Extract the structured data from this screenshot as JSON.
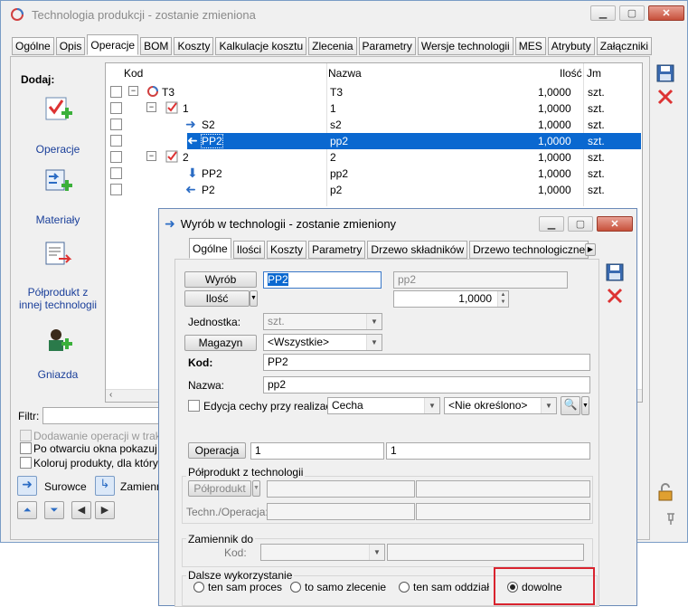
{
  "main": {
    "title": "Technologia produkcji - zostanie zmieniona",
    "tabs": [
      "Ogólne",
      "Opis",
      "Operacje",
      "BOM",
      "Koszty",
      "Kalkulacje kosztu",
      "Zlecenia",
      "Parametry",
      "Wersje technologii",
      "MES",
      "Atrybuty",
      "Załączniki"
    ],
    "active_tab": "Operacje",
    "add_label": "Dodaj:",
    "add_items": [
      "Operacje",
      "Materiały",
      "Półprodukt z innej technologii",
      "Gniazda"
    ],
    "tree_headers": {
      "kod": "Kod",
      "nazwa": "Nazwa",
      "ilosc": "Ilość",
      "jm": "Jm"
    },
    "tree_rows": [
      {
        "kod": "T3",
        "nazwa": "T3",
        "ilosc": "1,0000",
        "jm": "szt."
      },
      {
        "kod": "1",
        "nazwa": "1",
        "ilosc": "1,0000",
        "jm": "szt."
      },
      {
        "kod": "S2",
        "nazwa": "s2",
        "ilosc": "1,0000",
        "jm": "szt."
      },
      {
        "kod": "PP2",
        "nazwa": "pp2",
        "ilosc": "1,0000",
        "jm": "szt."
      },
      {
        "kod": "2",
        "nazwa": "2",
        "ilosc": "1,0000",
        "jm": "szt."
      },
      {
        "kod": "PP2",
        "nazwa": "pp2",
        "ilosc": "1,0000",
        "jm": "szt."
      },
      {
        "kod": "P2",
        "nazwa": "p2",
        "ilosc": "1,0000",
        "jm": "szt."
      }
    ],
    "filter_label": "Filtr:",
    "options": [
      "Dodawanie operacji w trakcie",
      "Po otwarciu okna pokazuj zwi",
      "Koloruj produkty, dla których"
    ],
    "surowce": "Surowce",
    "zamiennik": "Zamiennik"
  },
  "dialog": {
    "title": "Wyrób w technologii - zostanie zmieniony",
    "tabs": [
      "Ogólne",
      "Ilości",
      "Koszty",
      "Parametry",
      "Drzewo składników",
      "Drzewo technologiczne"
    ],
    "active_tab": "Ogólne",
    "wyrob_btn": "Wyrób",
    "wyrob_code": "PP2",
    "wyrob_name": "pp2",
    "ilosc_btn": "Ilość",
    "ilosc_value": "1,0000",
    "jednostka_label": "Jednostka:",
    "jednostka_value": "szt.",
    "magazyn_btn": "Magazyn",
    "magazyn_value": "<Wszystkie>",
    "kod_label": "Kod:",
    "kod_value": "PP2",
    "nazwa_label": "Nazwa:",
    "nazwa_value": "pp2",
    "edycja_label": "Edycja cechy przy realizacji",
    "cecha_value": "Cecha",
    "nieokreslono": "<Nie określono>",
    "operacja_btn": "Operacja",
    "operacja_1": "1",
    "operacja_2": "1",
    "polprodukt_group": "Półprodukt z technologii",
    "polprodukt_btn": "Półprodukt",
    "techn_label": "Techn./Operacja:",
    "zamiennik_group": "Zamiennik do",
    "zam_kod_label": "Kod:",
    "dalsze_group": "Dalsze wykorzystanie",
    "radios": [
      "ten sam proces",
      "to samo zlecenie",
      "ten sam oddział",
      "dowolne"
    ],
    "selected_radio": "dowolne",
    "highlight_color": "#d9232e"
  }
}
